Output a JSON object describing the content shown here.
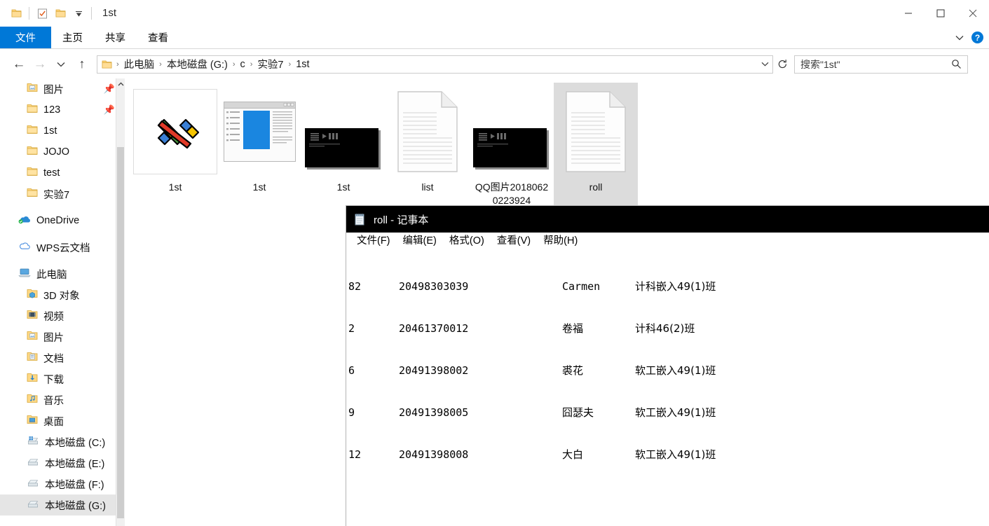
{
  "explorer": {
    "title": "1st",
    "quick_access": [
      {
        "name": "folder-icon",
        "label": "folder"
      },
      {
        "name": "properties-icon",
        "label": "properties"
      },
      {
        "name": "new-folder-icon",
        "label": "new folder"
      },
      {
        "name": "customize-dropdown-icon",
        "label": "customize"
      }
    ],
    "window_controls": {
      "minimize": "—",
      "maximize": "□",
      "close": "✕"
    },
    "ribbon_tabs": [
      {
        "label": "文件",
        "active": true
      },
      {
        "label": "主页",
        "active": false
      },
      {
        "label": "共享",
        "active": false
      },
      {
        "label": "查看",
        "active": false
      }
    ],
    "ribbon_help": "?",
    "nav": {
      "back": "←",
      "forward": "→",
      "recent": "⌄",
      "up": "↑",
      "refresh": "↻"
    },
    "breadcrumb": [
      "此电脑",
      "本地磁盘 (G:)",
      "c",
      "实验7",
      "1st"
    ],
    "breadcrumb_sep": "›",
    "search": {
      "placeholder": "搜索\"1st\"",
      "value": "",
      "icon": "search-icon"
    },
    "sidebar": [
      {
        "label": "图片",
        "icon": "pictures-folder-icon",
        "pinned": true,
        "indent": 1,
        "selected": false
      },
      {
        "label": "123",
        "icon": "folder-icon",
        "pinned": true,
        "indent": 1,
        "selected": false
      },
      {
        "label": "1st",
        "icon": "folder-icon",
        "pinned": false,
        "indent": 1,
        "selected": false
      },
      {
        "label": "JOJO",
        "icon": "folder-icon",
        "pinned": false,
        "indent": 1,
        "selected": false
      },
      {
        "label": "test",
        "icon": "folder-icon",
        "pinned": false,
        "indent": 1,
        "selected": false
      },
      {
        "label": "实验7",
        "icon": "folder-icon",
        "pinned": false,
        "indent": 1,
        "selected": false
      },
      {
        "label": "",
        "icon": "gap",
        "gap": true
      },
      {
        "label": "OneDrive",
        "icon": "onedrive-icon",
        "pinned": false,
        "indent": 0,
        "selected": false
      },
      {
        "label": "",
        "icon": "gap",
        "gap": true
      },
      {
        "label": "WPS云文档",
        "icon": "wps-cloud-icon",
        "pinned": false,
        "indent": 0,
        "selected": false
      },
      {
        "label": "",
        "icon": "gap",
        "gap": true
      },
      {
        "label": "此电脑",
        "icon": "this-pc-icon",
        "pinned": false,
        "indent": 0,
        "selected": false
      },
      {
        "label": "3D 对象",
        "icon": "3d-objects-icon",
        "pinned": false,
        "indent": 1,
        "selected": false
      },
      {
        "label": "视频",
        "icon": "videos-icon",
        "pinned": false,
        "indent": 1,
        "selected": false
      },
      {
        "label": "图片",
        "icon": "pictures-icon",
        "pinned": false,
        "indent": 1,
        "selected": false
      },
      {
        "label": "文档",
        "icon": "documents-icon",
        "pinned": false,
        "indent": 1,
        "selected": false
      },
      {
        "label": "下载",
        "icon": "downloads-icon",
        "pinned": false,
        "indent": 1,
        "selected": false
      },
      {
        "label": "音乐",
        "icon": "music-icon",
        "pinned": false,
        "indent": 1,
        "selected": false
      },
      {
        "label": "桌面",
        "icon": "desktop-icon",
        "pinned": false,
        "indent": 1,
        "selected": false
      },
      {
        "label": "本地磁盘 (C:)",
        "icon": "windows-drive-icon",
        "pinned": false,
        "indent": 1,
        "selected": false
      },
      {
        "label": "本地磁盘 (E:)",
        "icon": "drive-icon",
        "pinned": false,
        "indent": 1,
        "selected": false
      },
      {
        "label": "本地磁盘 (F:)",
        "icon": "drive-icon",
        "pinned": false,
        "indent": 1,
        "selected": false
      },
      {
        "label": "本地磁盘 (G:)",
        "icon": "drive-icon",
        "pinned": false,
        "indent": 1,
        "selected": true
      }
    ],
    "files": [
      {
        "name": "1st",
        "icon": "winrar-archive-icon",
        "selected": false
      },
      {
        "name": "1st",
        "icon": "document-preview-icon",
        "selected": false
      },
      {
        "name": "1st",
        "icon": "console-app-icon",
        "selected": false
      },
      {
        "name": "list",
        "icon": "text-file-icon",
        "selected": false
      },
      {
        "name": "QQ图片20180620223924",
        "icon": "console-app-icon",
        "selected": false
      },
      {
        "name": "roll",
        "icon": "text-file-icon",
        "selected": true
      }
    ]
  },
  "notepad": {
    "title": "roll - 记事本",
    "icon": "notepad-icon",
    "menus": [
      {
        "label": "文件(F)"
      },
      {
        "label": "编辑(E)"
      },
      {
        "label": "格式(O)"
      },
      {
        "label": "查看(V)"
      },
      {
        "label": "帮助(H)"
      }
    ],
    "rows": [
      {
        "num": "82",
        "id": "20498303039",
        "name": "Carmen",
        "class": "计科嵌入49(1)班"
      },
      {
        "num": "2",
        "id": "20461370012",
        "name": "卷福",
        "class": "计科46(2)班"
      },
      {
        "num": "6",
        "id": "20491398002",
        "name": "裘花",
        "class": "软工嵌入49(1)班"
      },
      {
        "num": "9",
        "id": "20491398005",
        "name": "囧瑟夫",
        "class": "软工嵌入49(1)班"
      },
      {
        "num": "12",
        "id": "20491398008",
        "name": "大白",
        "class": "软工嵌入49(1)班"
      }
    ]
  },
  "colors": {
    "accent": "#0078d7",
    "selection": "#dcdcdc",
    "nav_selected": "#e5e5e5",
    "notepad_titlebar": "#000000"
  }
}
